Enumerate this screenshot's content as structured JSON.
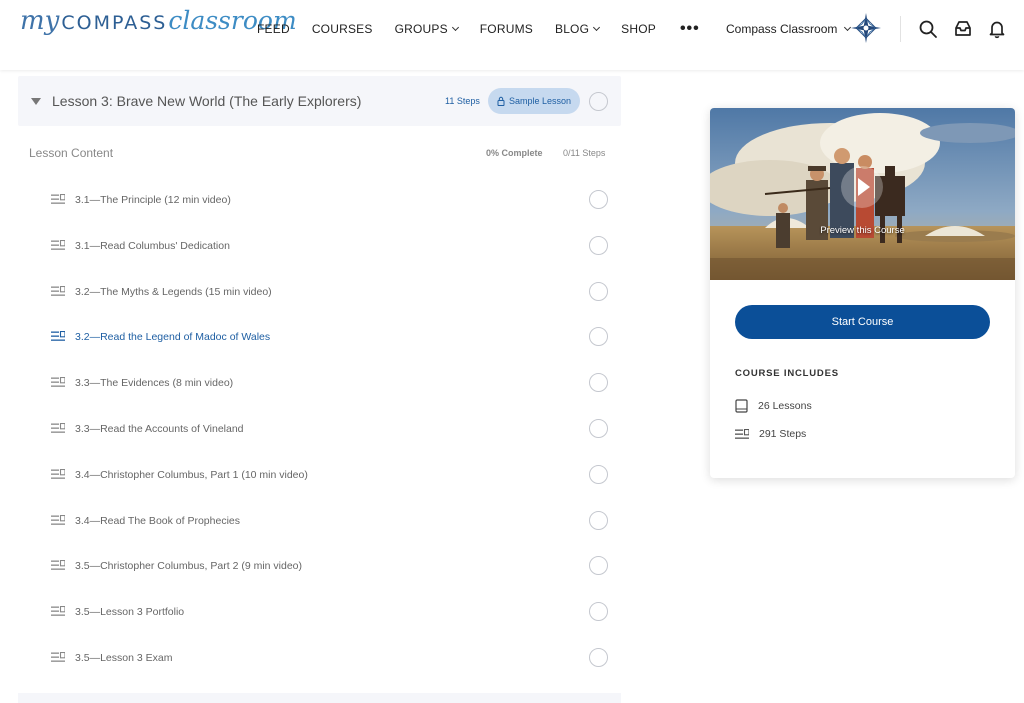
{
  "header": {
    "logo": {
      "my": "my",
      "compass": "COMPASS",
      "classroom": "classroom"
    },
    "nav": [
      {
        "label": "FEED",
        "dropdown": false
      },
      {
        "label": "COURSES",
        "dropdown": false
      },
      {
        "label": "GROUPS",
        "dropdown": true
      },
      {
        "label": "FORUMS",
        "dropdown": false
      },
      {
        "label": "BLOG",
        "dropdown": true
      },
      {
        "label": "SHOP",
        "dropdown": false
      }
    ],
    "more": "•••",
    "account_name": "Compass Classroom",
    "icons": [
      "search-icon",
      "inbox-icon",
      "bell-icon"
    ]
  },
  "lesson": {
    "title": "Lesson 3: Brave New World (The Early Explorers)",
    "steps_label": "11 Steps",
    "badge": "Sample Lesson"
  },
  "lesson_content": {
    "title": "Lesson Content",
    "complete": "0% Complete",
    "steps": "0/11 Steps"
  },
  "steps": [
    {
      "label": "3.1—The Principle (12 min video)",
      "active": false
    },
    {
      "label": "3.1—Read Columbus' Dedication",
      "active": false
    },
    {
      "label": "3.2—The Myths & Legends (15 min video)",
      "active": false
    },
    {
      "label": "3.2—Read the Legend of Madoc of Wales",
      "active": true
    },
    {
      "label": "3.3—The Evidences (8 min video)",
      "active": false
    },
    {
      "label": "3.3—Read the Accounts of Vineland",
      "active": false
    },
    {
      "label": "3.4—Christopher Columbus, Part 1 (10 min video)",
      "active": false
    },
    {
      "label": "3.4—Read The Book of Prophecies",
      "active": false
    },
    {
      "label": "3.5—Christopher Columbus, Part 2 (9 min video)",
      "active": false
    },
    {
      "label": "3.5—Lesson 3 Portfolio",
      "active": false
    },
    {
      "label": "3.5—Lesson 3 Exam",
      "active": false
    }
  ],
  "course_card": {
    "preview_label": "Preview this Course",
    "start_button": "Start Course",
    "includes_title": "COURSE INCLUDES",
    "includes": [
      {
        "icon": "book-icon",
        "text": "26 Lessons"
      },
      {
        "icon": "steps-icon",
        "text": "291 Steps"
      }
    ]
  },
  "colors": {
    "primary": "#0b4f98",
    "link": "#1f5fa3",
    "badge_bg": "#c6d9ef",
    "panel_bg": "#f5f6fa"
  }
}
